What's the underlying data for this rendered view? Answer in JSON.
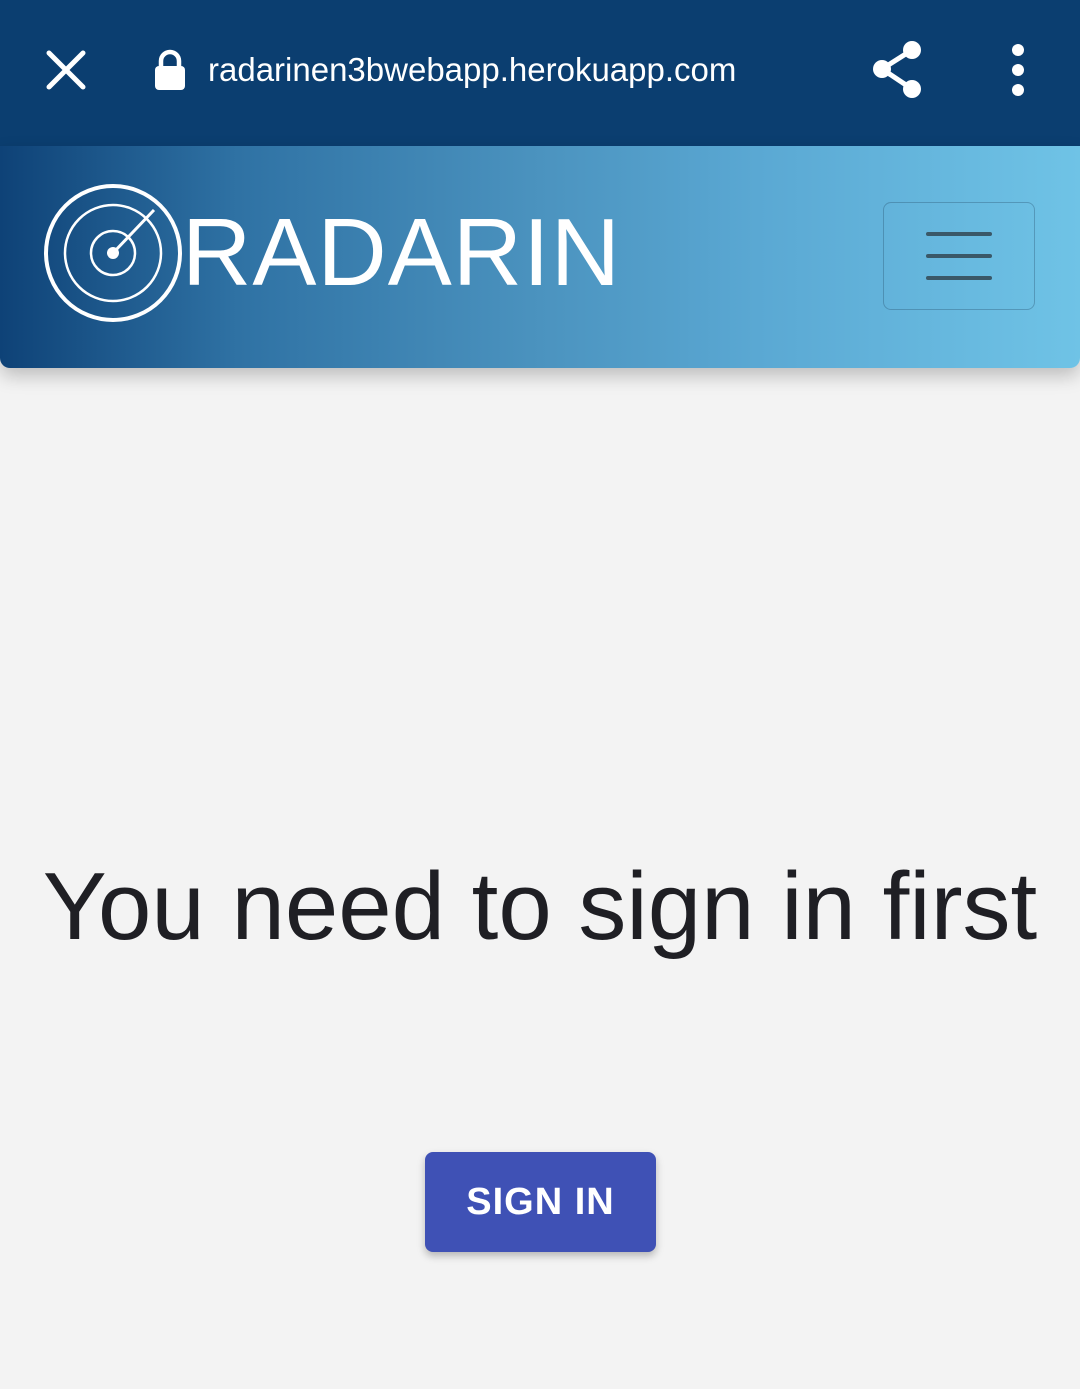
{
  "browser": {
    "url": "radarinen3bwebapp.herokuapp.com",
    "icons": {
      "close": "close-icon",
      "lock": "lock-icon",
      "share": "share-icon",
      "menu": "more-vertical-icon"
    },
    "colors": {
      "bar_background": "#0b3e70"
    }
  },
  "app": {
    "brand_name": "RADARIN",
    "logo_icon": "radar-icon",
    "menu_icon": "hamburger-menu-icon",
    "colors": {
      "header_gradient_start": "#0e4277",
      "header_gradient_end": "#6fc3e6"
    }
  },
  "main": {
    "message": "You need to sign in first",
    "sign_in_label": "SIGN IN",
    "colors": {
      "button": "#3f51b5",
      "background": "#f3f3f3"
    }
  }
}
